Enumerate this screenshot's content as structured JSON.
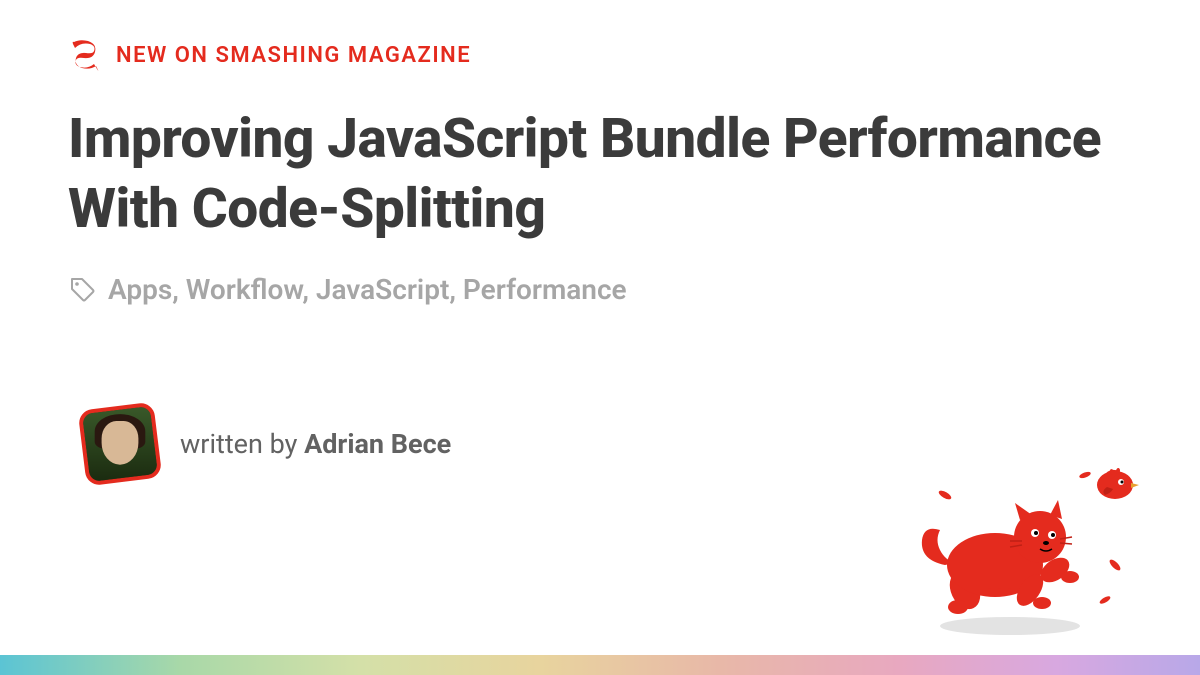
{
  "kicker": "NEW ON SMASHING MAGAZINE",
  "title": "Improving JavaScript Bundle Performance With Code-Splitting",
  "tags": "Apps, Workflow, JavaScript, Performance",
  "author": {
    "written_by_label": "written by ",
    "name": "Adrian Bece"
  },
  "colors": {
    "brand_red": "#e42b1e",
    "text_dark": "#3b3b3b",
    "text_muted": "#a6a6a6",
    "text_gray": "#626262"
  }
}
